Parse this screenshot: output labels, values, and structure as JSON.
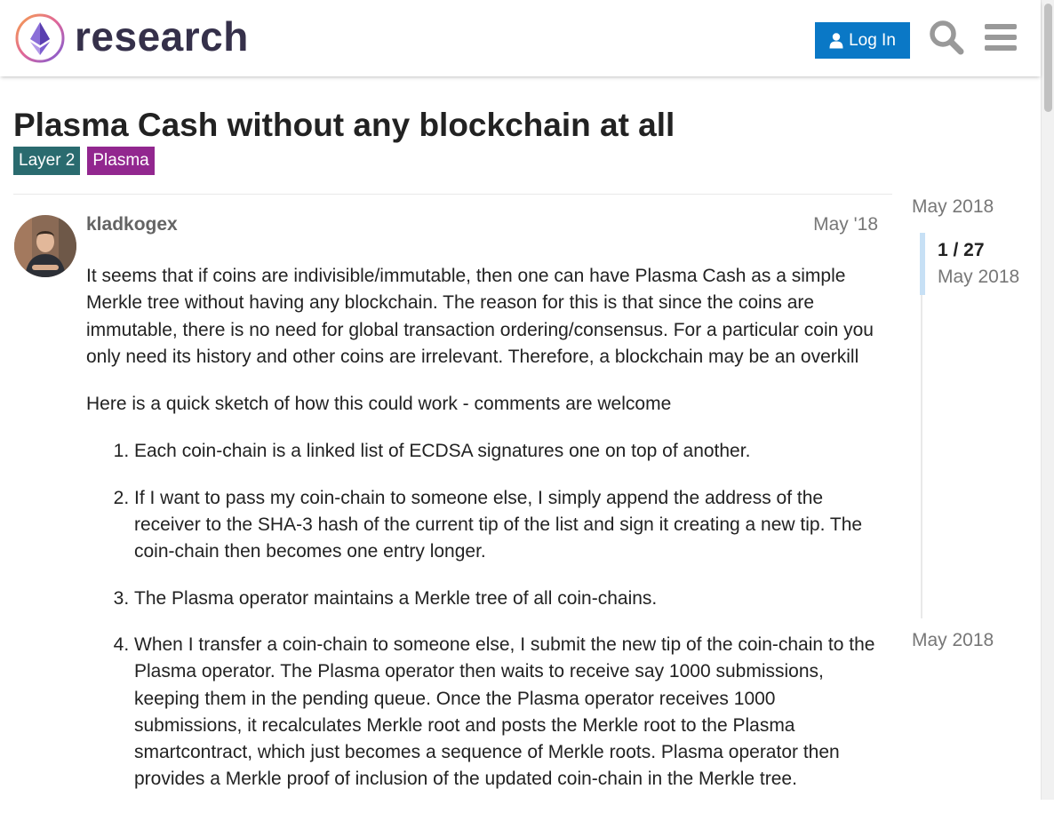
{
  "header": {
    "site_name": "research",
    "login_label": "Log In",
    "icons": [
      "logo-icon",
      "user-icon",
      "search-icon",
      "menu-icon"
    ]
  },
  "topic": {
    "title": "Plasma Cash without any blockchain at all",
    "tags": [
      {
        "label": "Layer 2",
        "color": "#2a6b6f"
      },
      {
        "label": "Plasma",
        "color": "#92278f"
      }
    ]
  },
  "post": {
    "author": "kladkogex",
    "date": "May '18",
    "paragraphs": [
      "It seems that if coins are indivisible/immutable, then one can have Plasma Cash as a simple Merkle tree without having any blockchain. The reason for this is that since the coins are immutable, there is no need for global transaction ordering/consensus. For a particular coin you only need its history and other coins are irrelevant. Therefore, a blockchain may be an overkill",
      "Here is a quick sketch of how this could work - comments are welcome"
    ],
    "list": [
      "Each coin-chain is a linked list of ECDSA signatures one on top of another.",
      "If I want to pass my coin-chain to someone else, I simply append the address of the receiver to the SHA-3 hash of the current tip of the list and sign it creating a new tip. The coin-chain then becomes one entry longer.",
      "The Plasma operator maintains a Merkle tree of all coin-chains.",
      "When I transfer a coin-chain to someone else, I submit the new tip of the coin-chain to the Plasma operator. The Plasma operator then waits to receive say 1000 submissions, keeping them in the pending queue. Once the Plasma operator receives 1000 submissions, it recalculates Merkle root and posts the Merkle root to the Plasma smartcontract, which just becomes a sequence of Merkle roots. Plasma operator then provides a Merkle proof of inclusion of the updated coin-chain in the Merkle tree."
    ]
  },
  "timeline": {
    "start_label": "May 2018",
    "position": "1 / 27",
    "position_date": "May 2018",
    "end_label": "May 2018"
  },
  "colors": {
    "accent": "#0a78c6",
    "tag_layer2": "#2a6b6f",
    "tag_plasma": "#92278f"
  }
}
